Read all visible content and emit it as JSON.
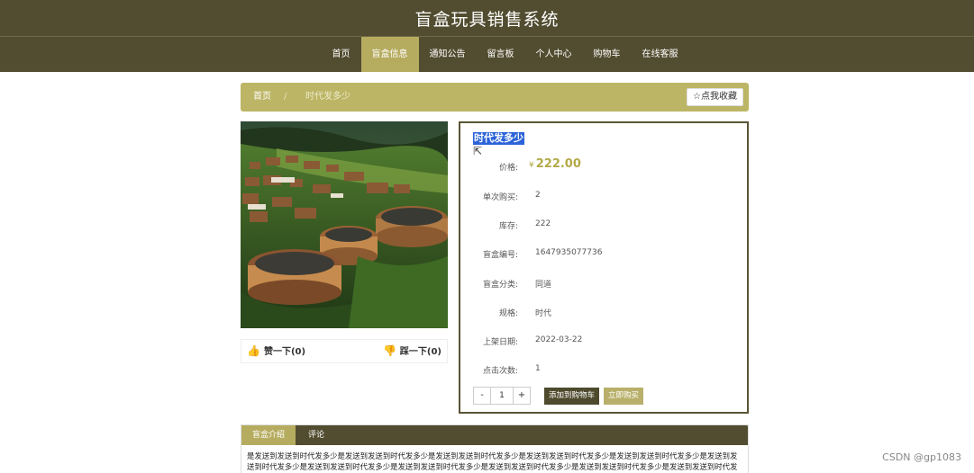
{
  "header": {
    "title": "盲盒玩具销售系统",
    "nav": [
      "首页",
      "盲盒信息",
      "通知公告",
      "留言板",
      "个人中心",
      "购物车",
      "在线客服"
    ],
    "active_index": 1
  },
  "breadcrumb": {
    "home": "首页",
    "separator": "/",
    "current": "时代发多少",
    "favorite_label": "☆点我收藏"
  },
  "product": {
    "name": "时代发多少",
    "votes": {
      "up": "赞一下(0)",
      "down": "踩一下(0)"
    },
    "price_label": "价格:",
    "currency": "¥",
    "price": "222.00",
    "rows": [
      {
        "label": "单次购买:",
        "value": "2"
      },
      {
        "label": "库存:",
        "value": "222"
      },
      {
        "label": "盲盒编号:",
        "value": "1647935077736"
      },
      {
        "label": "盲盒分类:",
        "value": "同道"
      },
      {
        "label": "规格:",
        "value": "时代"
      },
      {
        "label": "上架日期:",
        "value": "2022-03-22"
      },
      {
        "label": "点击次数:",
        "value": "1"
      }
    ],
    "quantity": {
      "minus": "-",
      "value": "1",
      "plus": "+"
    },
    "add_to_cart": "添加到购物车",
    "buy_now": "立即购买"
  },
  "tabs": {
    "items": [
      "盲盒介绍",
      "评论"
    ],
    "active_index": 0,
    "content": "是发送到发送到时代发多少是发送到发送到时代发多少是发送到发送到时代发多少是发送到发送到时代发多少是发送到发送到时代发多少是发送到发送到时代发多少是发送到发送到时代发多少是发送到发送到时代发多少是发送到发送到时代发多少是发送到发送到时代发多少是发送到发送到时代发多少是发送到发送到时代发多少是发送到发送到时代发多少是发送到发送到时代发多少是发送到发送到时代发多少是发送到发送到"
  },
  "watermark": "CSDN @gp1083",
  "colors": {
    "header_bg": "#524d30",
    "accent": "#b6ac60",
    "price": "#b4a947",
    "vote_icon": "#e05a4e"
  },
  "icons": [
    "thumbs-up-icon",
    "thumbs-down-icon",
    "mouse-cursor-icon"
  ]
}
